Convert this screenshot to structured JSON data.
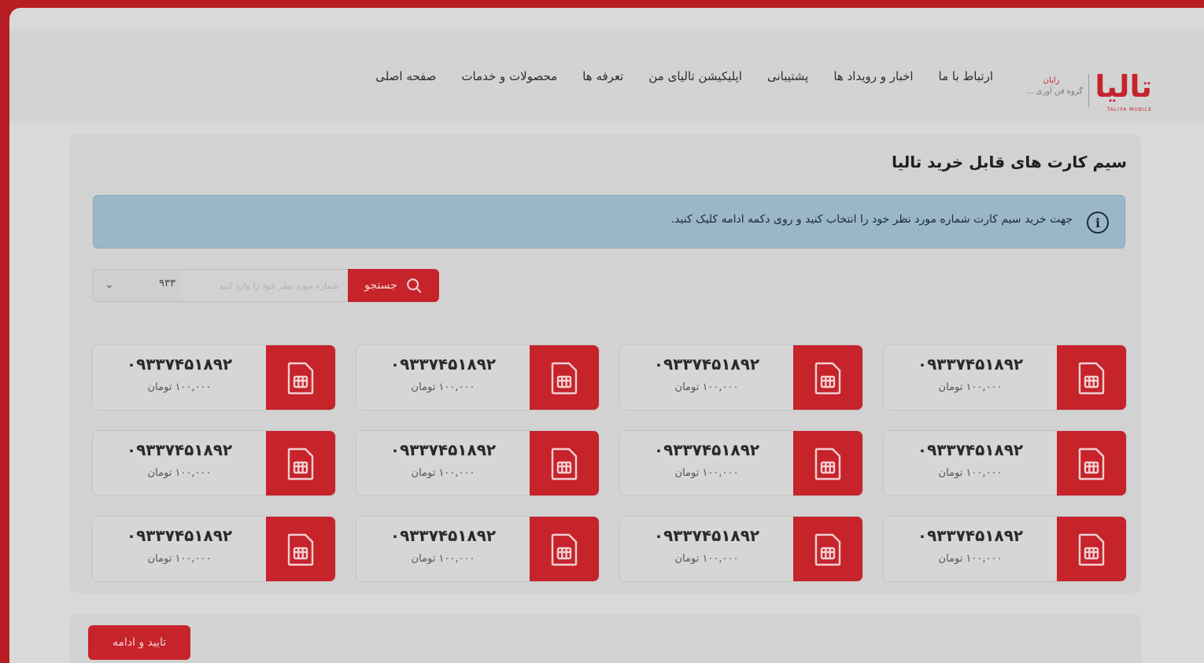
{
  "brand": {
    "logo_text": "تالیا",
    "tagline": "TALIYA MOBILE",
    "sub_red": "رایان",
    "sub_text": "گروه فن آوری ...",
    "accent_color": "#c6232b"
  },
  "nav": {
    "items": [
      {
        "label": "صفحه اصلی"
      },
      {
        "label": "محصولات و خدمات"
      },
      {
        "label": "تعرفه ها"
      },
      {
        "label": "اپلیکیشن تالیای من"
      },
      {
        "label": "پشتیبانی"
      },
      {
        "label": "اخبار و رویداد ها"
      },
      {
        "label": "ارتباط با ما"
      }
    ]
  },
  "main": {
    "title": "سیم کارت های قابل خرید تالیا",
    "info_icon": "info-icon",
    "info_text": "جهت خرید سیم کارت شماره مورد نظر خود را انتخاب کنید و روی دکمه ادامه کلیک کنید."
  },
  "search": {
    "prefix_value": "۹۳۳",
    "placeholder": "شماره مورد نظر خود را وارد کنید",
    "button_label": "جستجو"
  },
  "sim_cards": [
    {
      "number": "۰۹۳۳۷۴۵۱۸۹۲",
      "price": "۱۰۰,۰۰۰ تومان"
    },
    {
      "number": "۰۹۳۳۷۴۵۱۸۹۲",
      "price": "۱۰۰,۰۰۰ تومان"
    },
    {
      "number": "۰۹۳۳۷۴۵۱۸۹۲",
      "price": "۱۰۰,۰۰۰ تومان"
    },
    {
      "number": "۰۹۳۳۷۴۵۱۸۹۲",
      "price": "۱۰۰,۰۰۰ تومان"
    },
    {
      "number": "۰۹۳۳۷۴۵۱۸۹۲",
      "price": "۱۰۰,۰۰۰ تومان"
    },
    {
      "number": "۰۹۳۳۷۴۵۱۸۹۲",
      "price": "۱۰۰,۰۰۰ تومان"
    },
    {
      "number": "۰۹۳۳۷۴۵۱۸۹۲",
      "price": "۱۰۰,۰۰۰ تومان"
    },
    {
      "number": "۰۹۳۳۷۴۵۱۸۹۲",
      "price": "۱۰۰,۰۰۰ تومان"
    },
    {
      "number": "۰۹۳۳۷۴۵۱۸۹۲",
      "price": "۱۰۰,۰۰۰ تومان"
    },
    {
      "number": "۰۹۳۳۷۴۵۱۸۹۲",
      "price": "۱۰۰,۰۰۰ تومان"
    },
    {
      "number": "۰۹۳۳۷۴۵۱۸۹۲",
      "price": "۱۰۰,۰۰۰ تومان"
    },
    {
      "number": "۰۹۳۳۷۴۵۱۸۹۲",
      "price": "۱۰۰,۰۰۰ تومان"
    }
  ],
  "footer": {
    "confirm_label": "تایید و ادامه"
  }
}
